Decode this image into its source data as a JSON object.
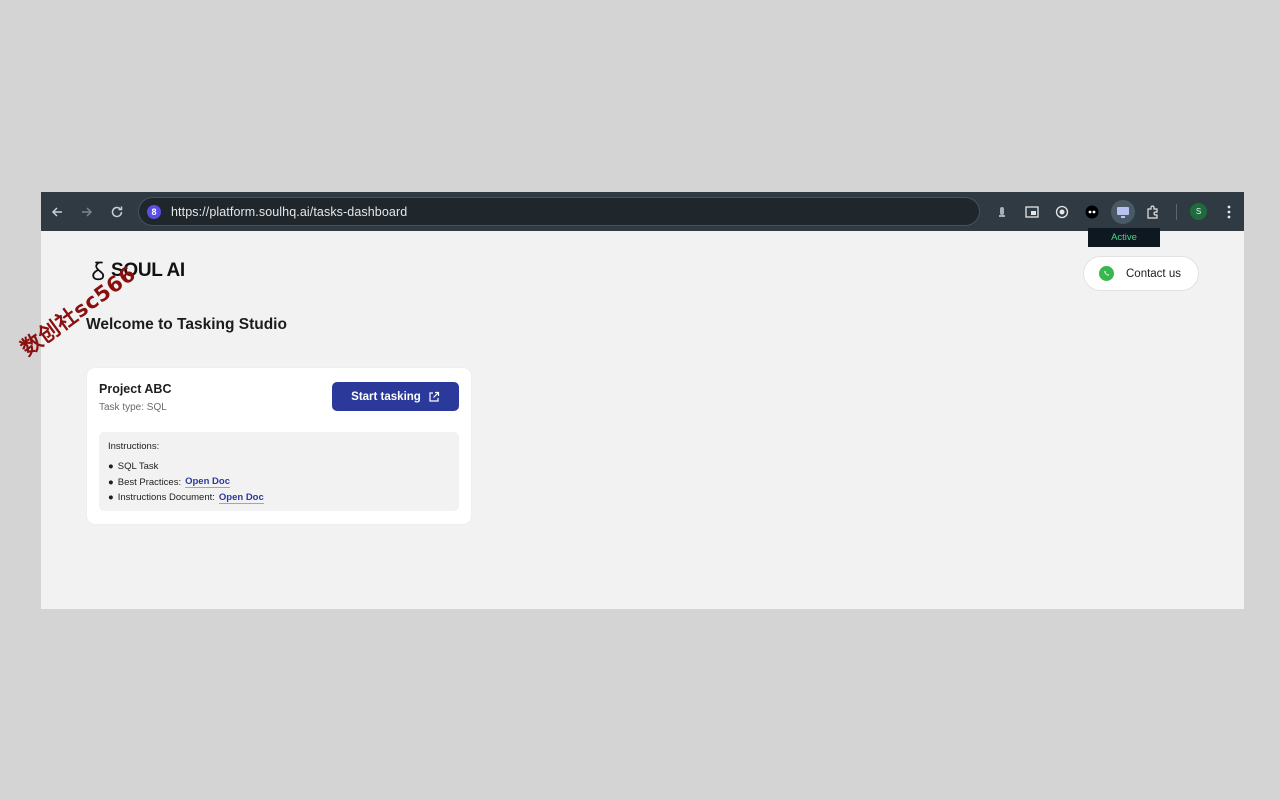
{
  "browser": {
    "url": "https://platform.soulhq.ai/tasks-dashboard",
    "profile_initial": "S",
    "extensions": [
      "download-icon",
      "picture-in-picture-icon",
      "record-icon",
      "dark-circle-icon",
      "monitor-icon",
      "puzzle-icon"
    ],
    "tooltip": "Active"
  },
  "header": {
    "logo_text": "SOUL AI",
    "contact_label": "Contact us"
  },
  "main": {
    "title": "Welcome to Tasking Studio"
  },
  "project": {
    "name": "Project ABC",
    "task_type": "Task type: SQL",
    "start_button": "Start tasking",
    "instructions_heading": "Instructions:",
    "items": [
      {
        "bullet": "●",
        "text": "SQL Task",
        "link": ""
      },
      {
        "bullet": "●",
        "text": "Best Practices:",
        "link": "Open Doc"
      },
      {
        "bullet": "●",
        "text": "Instructions Document:",
        "link": "Open Doc"
      }
    ]
  },
  "watermark": "数创社sc566",
  "colors": {
    "toolbar": "#2f3a42",
    "accent": "#2b3a9a",
    "page_bg": "#f2f2f2",
    "whatsapp": "#35b84c"
  }
}
